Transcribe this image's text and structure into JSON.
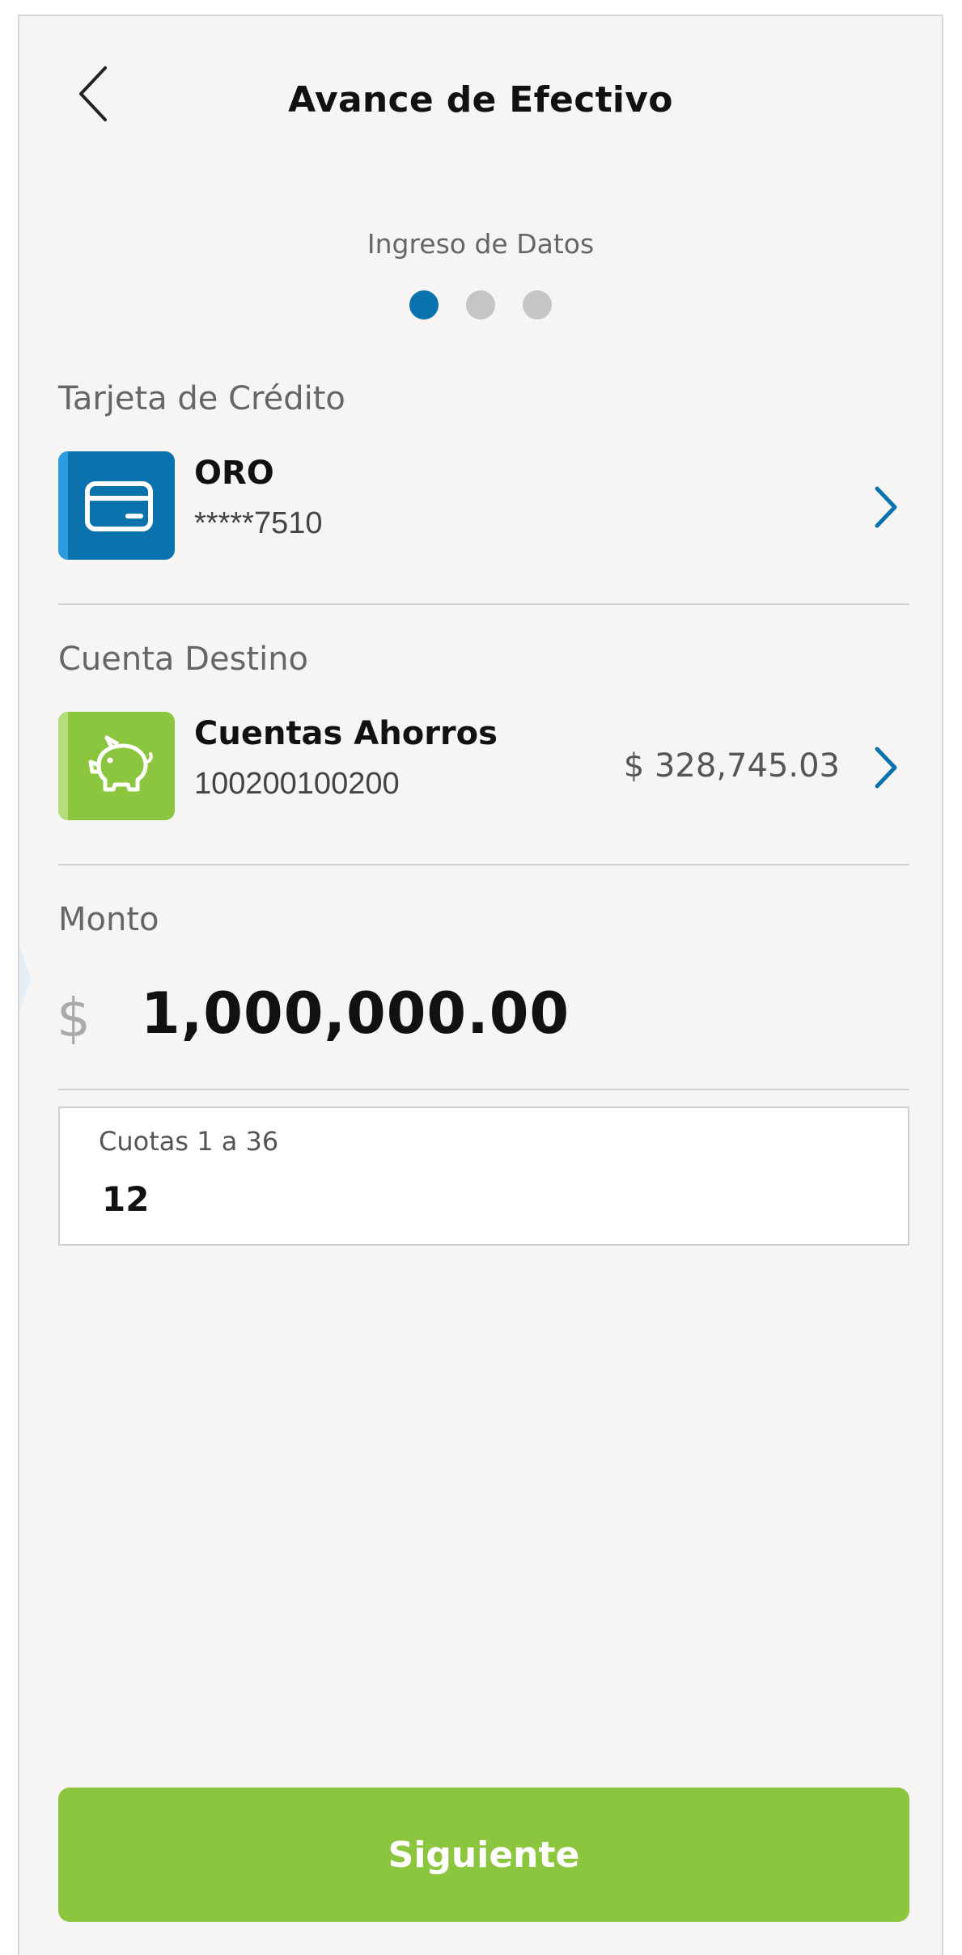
{
  "header": {
    "title": "Avance de Efectivo"
  },
  "stepper": {
    "label": "Ingreso de Datos",
    "total_steps": 3,
    "current_step": 1
  },
  "colors": {
    "primary_blue": "#0a72ad",
    "primary_green": "#8cc63f",
    "inactive_dot": "#c5c5c5"
  },
  "credit_card": {
    "section_label": "Tarjeta de Crédito",
    "name": "ORO",
    "number": "*****7510",
    "icon": "credit-card-icon"
  },
  "destination": {
    "section_label": "Cuenta Destino",
    "name": "Cuentas Ahorros",
    "number": "100200100200",
    "balance": "$ 328,745.03",
    "icon": "piggy-bank-icon"
  },
  "amount": {
    "section_label": "Monto",
    "currency_symbol": "$",
    "value": "1,000,000.00"
  },
  "installments": {
    "label": "Cuotas 1 a 36",
    "value": "12"
  },
  "actions": {
    "next_label": "Siguiente"
  }
}
